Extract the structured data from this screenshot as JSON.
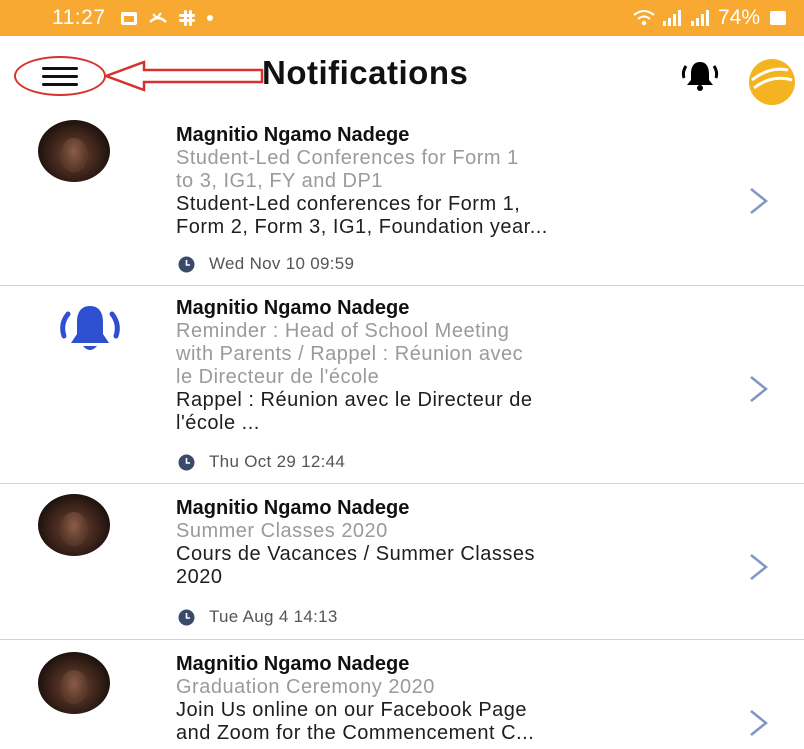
{
  "status_bar": {
    "time": "11:27",
    "icons": [
      "calendar-icon",
      "missed-call-icon",
      "slack-icon",
      "dot-icon"
    ],
    "battery": "74%",
    "color": "#f8a932"
  },
  "header": {
    "title": "Notifications",
    "menu_icon": "hamburger-menu-icon",
    "bell_icon": "bell-ringing-icon",
    "logo_icon": "school-logo-icon"
  },
  "notifications": [
    {
      "sender": "Magnitio Ngamo Nadege",
      "subject_line1": "Student-Led Conferences for Form 1",
      "subject_line2": "to 3, IG1, FY and DP1",
      "preview_line1": "Student-Led conferences for Form 1,",
      "preview_line2": "Form 2, Form 3, IG1, Foundation year...",
      "date": "Wed Nov 10 09:59",
      "icon": "avatar"
    },
    {
      "sender": "Magnitio Ngamo Nadege",
      "subject_line1": "Reminder : Head of School Meeting",
      "subject_line2": "with Parents / Rappel : Réunion avec",
      "subject_line3": "le Directeur de l'école",
      "preview_line1": "Rappel : Réunion avec le Directeur de",
      "preview_line2": "l'école ...",
      "date": "Thu Oct 29 12:44",
      "icon": "bell-icon"
    },
    {
      "sender": "Magnitio Ngamo Nadege",
      "subject_line1": "Summer Classes 2020",
      "preview_line1": "Cours de Vacances / Summer Classes",
      "preview_line2": "2020",
      "date": "Tue Aug 4 14:13",
      "icon": "avatar"
    },
    {
      "sender": "Magnitio Ngamo Nadege",
      "subject_line1": "Graduation Ceremony 2020",
      "preview_line1": "Join Us online on our Facebook Page",
      "preview_line2": "and Zoom for the Commencement C...",
      "icon": "avatar"
    }
  ],
  "colors": {
    "accent": "#f8a932",
    "bell_blue": "#2f4fd1",
    "subject_gray": "#9a9a9a",
    "chevron": "#7f95c6",
    "annotation_red": "#d6322c"
  }
}
